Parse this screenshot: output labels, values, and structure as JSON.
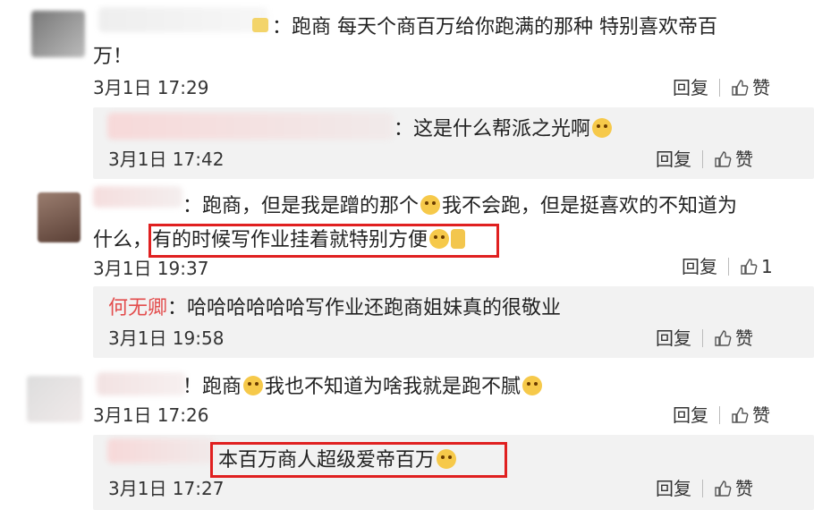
{
  "comments": [
    {
      "text_line1": "：跑商 每天个商百万给你跑满的那种 特别喜欢帝百",
      "text_line2": "万！",
      "time": "3月1日 17:29",
      "reply_label": "回复",
      "like_label": "赞"
    },
    {
      "text": "：这是什么帮派之光啊",
      "time": "3月1日 17:42",
      "reply_label": "回复",
      "like_label": "赞"
    },
    {
      "text_line1_a": "：跑商，但是我是蹭的那个",
      "text_line1_b": "我不会跑，但是挺喜欢的不知道为",
      "text_line2_prefix": "什么，",
      "text_line2_highlight": "有的时候写作业挂着就特别方便",
      "time": "3月1日 19:37",
      "reply_label": "回复",
      "like_count": "1"
    },
    {
      "name": "何无卿",
      "text": "：哈哈哈哈哈哈写作业还跑商姐妹真的很敬业",
      "time": "3月1日 19:58",
      "reply_label": "回复",
      "like_label": "赞"
    },
    {
      "text_a": "！跑商",
      "text_b": "我也不知道为啥我就是跑不腻",
      "time": "3月1日 17:26",
      "reply_label": "回复",
      "like_label": "赞"
    },
    {
      "text": "本百万商人超级爱帝百万",
      "time": "3月1日 17:27",
      "reply_label": "回复",
      "like_label": "赞"
    }
  ],
  "colors": {
    "highlight_frame": "#e02020",
    "reply_bg": "#f2f2f2",
    "name_red": "#e34d4d"
  }
}
